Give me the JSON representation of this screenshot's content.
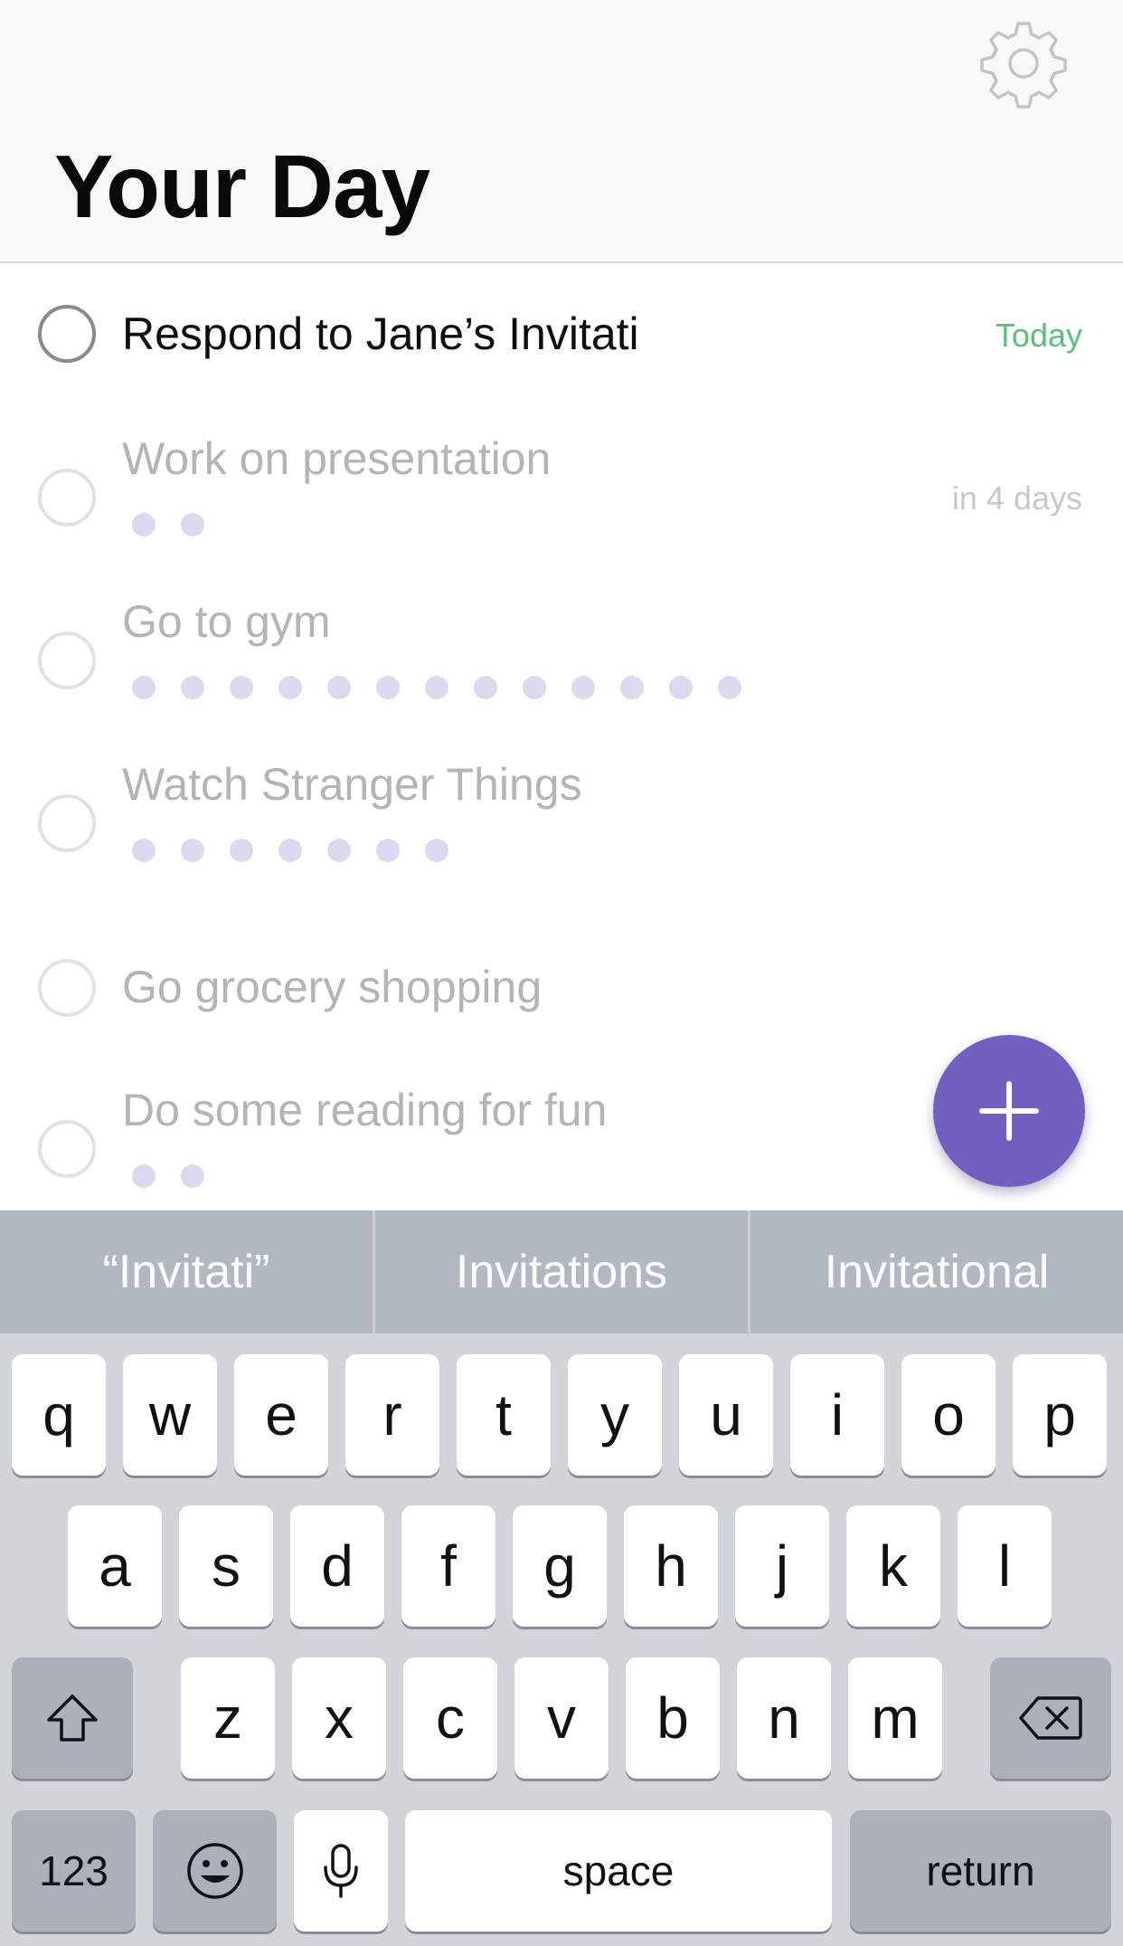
{
  "header": {
    "title": "Your Day",
    "settings_icon": "gear-icon"
  },
  "tasks": [
    {
      "text": "Respond to Jane’s Invitati",
      "due": "Today",
      "dots": 0,
      "active": true
    },
    {
      "text": "Work on presentation",
      "due": "in 4 days",
      "dots": 2,
      "active": false
    },
    {
      "text": "Go to gym",
      "due": "",
      "dots": 13,
      "active": false
    },
    {
      "text": "Watch Stranger Things",
      "due": "",
      "dots": 7,
      "active": false
    },
    {
      "text": "Go grocery shopping",
      "due": "",
      "dots": 0,
      "active": false
    },
    {
      "text": "Do some reading for fun",
      "due": "",
      "dots": 2,
      "active": false
    }
  ],
  "colors": {
    "accent": "#735fc0",
    "today": "#5bbf79",
    "dot": "#dcd8ee"
  },
  "suggestions": [
    "“Invitati”",
    "Invitations",
    "Invitational"
  ],
  "keyboard": {
    "row1": [
      "q",
      "w",
      "e",
      "r",
      "t",
      "y",
      "u",
      "i",
      "o",
      "p"
    ],
    "row2": [
      "a",
      "s",
      "d",
      "f",
      "g",
      "h",
      "j",
      "k",
      "l"
    ],
    "row3": [
      "z",
      "x",
      "c",
      "v",
      "b",
      "n",
      "m"
    ],
    "numbers": "123",
    "space": "space",
    "return": "return",
    "icons": [
      "shift-icon",
      "backspace-icon",
      "emoji-icon",
      "microphone-icon"
    ]
  }
}
